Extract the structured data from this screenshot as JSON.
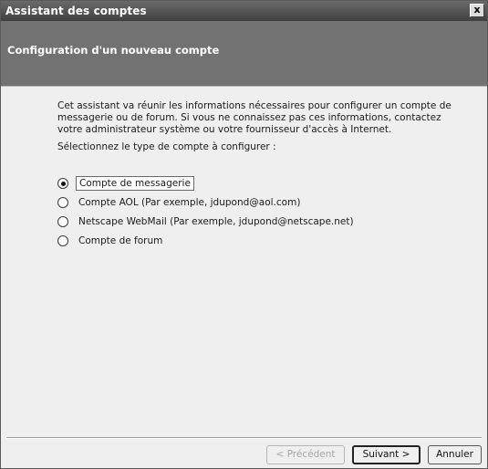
{
  "window": {
    "title": "Assistant des comptes",
    "close_glyph": "x"
  },
  "header": {
    "title": "Configuration d'un nouveau compte"
  },
  "main": {
    "intro": "Cet assistant va réunir les informations nécessaires pour configurer un compte de messagerie ou de forum. Si vous ne connaissez pas ces informations, contactez votre administrateur système ou votre fournisseur d'accès à Internet.",
    "prompt": "Sélectionnez le type de compte à configurer :",
    "options": [
      {
        "label": "Compte de messagerie",
        "selected": true
      },
      {
        "label": "Compte AOL (Par exemple, jdupond@aol.com)",
        "selected": false
      },
      {
        "label": "Netscape WebMail (Par exemple, jdupond@netscape.net)",
        "selected": false
      },
      {
        "label": "Compte de forum",
        "selected": false
      }
    ]
  },
  "footer": {
    "back_label": "< Précédent",
    "next_label": "Suivant >",
    "cancel_label": "Annuler"
  }
}
